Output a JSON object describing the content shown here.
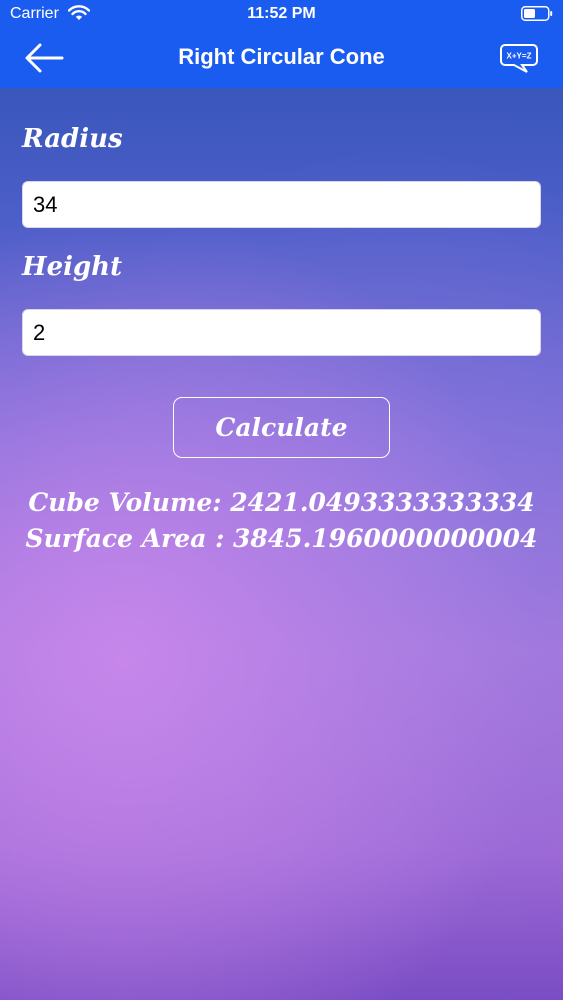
{
  "status_bar": {
    "carrier": "Carrier",
    "time": "11:52 PM"
  },
  "nav": {
    "title": "Right Circular Cone",
    "back_icon": "arrow-left-icon",
    "formula_icon": "xyz-speech-bubble-icon",
    "formula_icon_text": "X+Y=Z"
  },
  "form": {
    "radius_label": "Radius",
    "radius_value": "34",
    "height_label": "Height",
    "height_value": "2",
    "calculate_label": "Calculate"
  },
  "results": {
    "volume": "Cube Volume: 2421.0493333333334",
    "surface_area": "Surface Area : 3845.1960000000004"
  },
  "colors": {
    "nav_bar": "#1a5cf0",
    "text": "#ffffff",
    "field_background": "#ffffff"
  }
}
